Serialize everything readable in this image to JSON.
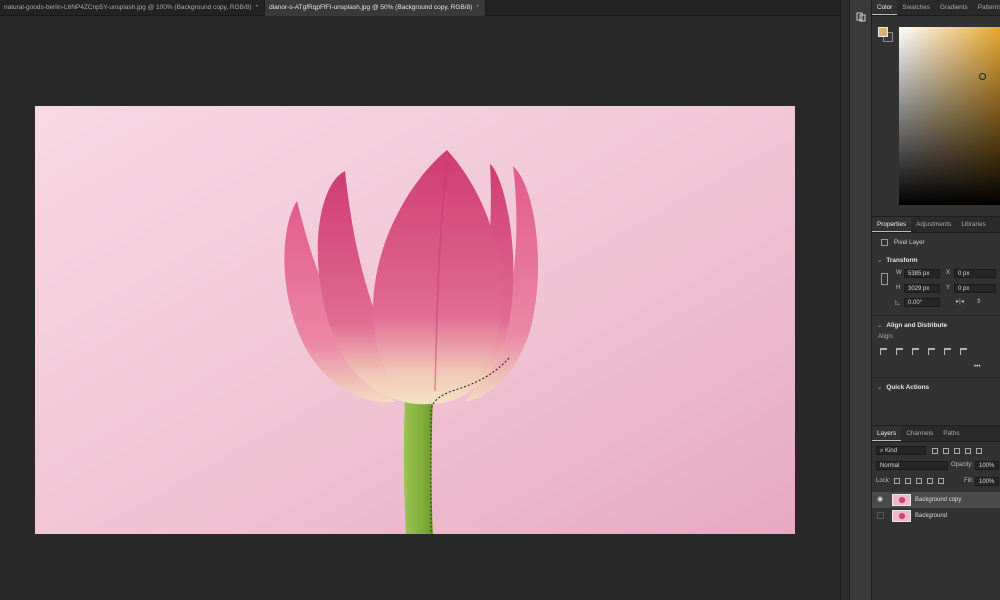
{
  "tabs": [
    {
      "label": "natural-goods-berlin-L6NP4ZCnp5Y-unsplash.jpg @ 100% (Background copy, RGB/8)",
      "active": false
    },
    {
      "label": "dianor-s-ATgfRqpFfFI-unsplash.jpg @ 50% (Background copy, RGB/8)",
      "active": true
    }
  ],
  "tab_close": "*",
  "color_panel": {
    "tabs": [
      "Color",
      "Swatches",
      "Gradients",
      "Patterns"
    ],
    "foreground": "#d7b46e",
    "background": "#3a3a3a",
    "hue": "#e8a830"
  },
  "properties": {
    "tabs": [
      "Properties",
      "Adjustments",
      "Libraries"
    ],
    "layer_type": "Pixel Layer",
    "transform": {
      "title": "Transform",
      "w_label": "W",
      "w_value": "5385 px",
      "h_label": "H",
      "h_value": "3029 px",
      "x_label": "X",
      "x_value": "0 px",
      "y_label": "Y",
      "y_value": "0 px",
      "angle": "0.00°"
    },
    "align": {
      "title": "Align and Distribute",
      "align_label": "Align:",
      "more": "•••"
    },
    "quick_actions": "Quick Actions"
  },
  "layers": {
    "tabs": [
      "Layers",
      "Channels",
      "Paths"
    ],
    "filter": "Kind",
    "blend_mode": "Normal",
    "opacity_label": "Opacity:",
    "opacity": "100%",
    "lock_label": "Lock:",
    "fill_label": "Fill:",
    "fill": "100%",
    "items": [
      {
        "name": "Background copy",
        "visible": true,
        "selected": true
      },
      {
        "name": "Background",
        "visible": false,
        "selected": false
      }
    ]
  },
  "colors": {
    "canvas_bg": "#f3cbd8",
    "petal": "#d9487a",
    "stem": "#86b33e"
  }
}
